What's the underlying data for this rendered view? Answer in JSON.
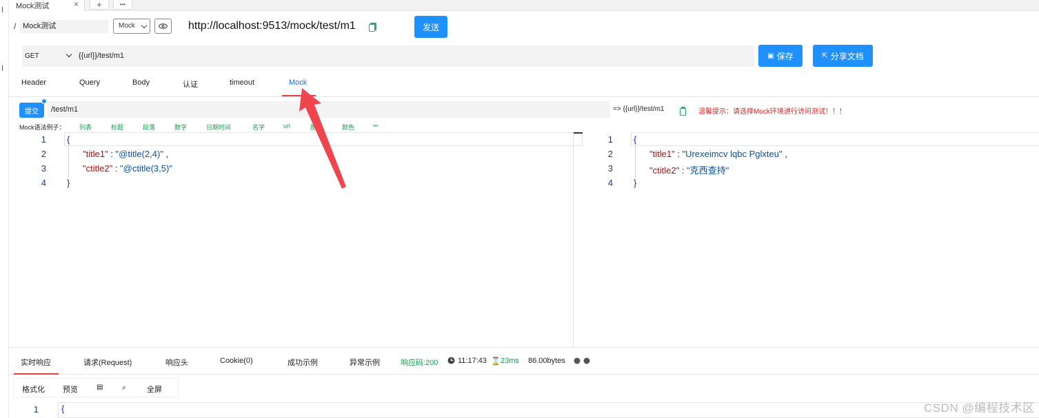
{
  "window": {
    "doc_tab_title": "Mock测试",
    "close_glyph": "×",
    "new_tab_glyph": "+",
    "more_glyph": "•••"
  },
  "request": {
    "breadcrumb_sep": "/",
    "name": "Mock测试",
    "env_select": "Mock",
    "full_url": "http://localhost:9513/mock/test/m1",
    "send_label": "发送",
    "method": "GET",
    "url": "{{url}}/test/m1",
    "save_label": "保存",
    "share_label": "分享文档"
  },
  "tabs": [
    "Header",
    "Query",
    "Body",
    "认证",
    "timeout",
    "Mock"
  ],
  "active_tab": "Mock",
  "mock": {
    "submit_label": "提交",
    "path": "/test/m1",
    "resolved_url": "=> {{url}}/test/m1",
    "warning": "温馨提示：请选择Mock环境进行访问测试！！！",
    "examples_label": "Mock语法例子：",
    "examples": [
      "列表",
      "标题",
      "段落",
      "数字",
      "日期时间",
      "名字",
      "url",
      "图",
      "颜色",
      "•••"
    ]
  },
  "left_editor": {
    "line_numbers": [
      "1",
      "2",
      "3",
      "4"
    ],
    "open": "{",
    "close": "}",
    "entries": [
      {
        "key": "\"title1\"",
        "sep": " : ",
        "value": "\"@title(2,4)\"",
        "trail": " ,"
      },
      {
        "key": "\"ctitle2\"",
        "sep": " : ",
        "value": "\"@ctitle(3,5)\"",
        "trail": ""
      }
    ]
  },
  "right_editor": {
    "line_numbers": [
      "1",
      "2",
      "3",
      "4"
    ],
    "open": "{",
    "close": "}",
    "entries": [
      {
        "key": "\"title1\"",
        "sep": " : ",
        "value": "\"Urexeimcv lqbc Pglxteu\"",
        "trail": " ,"
      },
      {
        "key": "\"ctitle2\"",
        "sep": " : ",
        "value": "\"克西查持\"",
        "trail": ""
      }
    ]
  },
  "response": {
    "tabs": [
      "实时响应",
      "请求(Request)",
      "响应头",
      "Cookie(0)",
      "成功示例",
      "异常示例"
    ],
    "status_code": "响应码:200",
    "time": "11:17:43",
    "duration": "23ms",
    "size": "86.00bytes",
    "tools": [
      "格式化",
      "预览",
      "▤",
      "⌕",
      "全屏"
    ],
    "line1": "1",
    "line1_code": "{"
  },
  "watermark": "CSDN @编程技术区",
  "colors": {
    "primary": "#1e90ff",
    "active_underline": "#e43b3b",
    "success_green": "#13a04f",
    "warning_red": "#e02020",
    "json_key": "#a31515",
    "json_value": "#0451a5",
    "annotation_arrow": "#f0454f"
  }
}
